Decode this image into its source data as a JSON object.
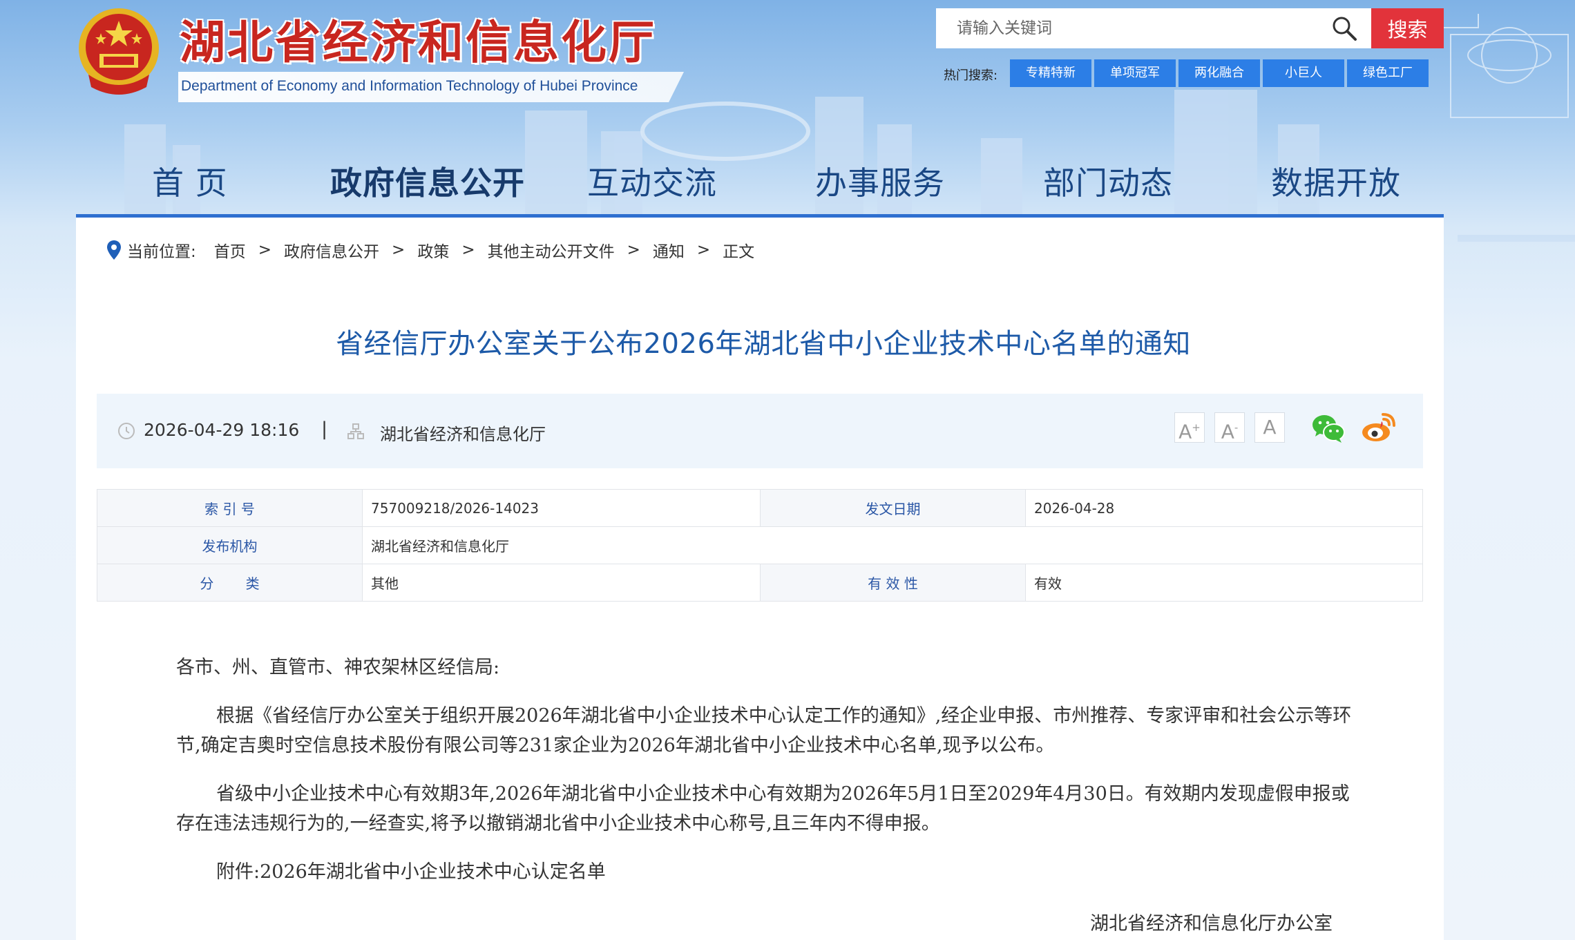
{
  "header": {
    "site_title": "湖北省经济和信息化厅",
    "site_subtitle": "Department of Economy and Information Technology of Hubei Province",
    "emblem_icon": "national-emblem"
  },
  "search": {
    "placeholder": "请输入关键词",
    "button_label": "搜索",
    "hot_label": "热门搜索:",
    "hot_tags": [
      "专精特新",
      "单项冠军",
      "两化融合",
      "小巨人",
      "绿色工厂"
    ]
  },
  "nav": {
    "items": [
      "首 页",
      "政府信息公开",
      "互动交流",
      "办事服务",
      "部门动态",
      "数据开放"
    ],
    "active": "政府信息公开"
  },
  "breadcrumb": {
    "label": "当前位置:",
    "items": [
      "首页",
      "政府信息公开",
      "政策",
      "其他主动公开文件",
      "通知",
      "正文"
    ],
    "separator": ">"
  },
  "article": {
    "title": "省经信厅办公室关于公布2026年湖北省中小企业技术中心名单的通知",
    "datetime": "2026-04-29 18:16",
    "divider": "|",
    "publisher": "湖北省经济和信息化厅",
    "font_buttons": [
      "A+",
      "A-",
      "A"
    ],
    "share_icons": [
      "wechat-icon",
      "weibo-icon"
    ]
  },
  "info_table": {
    "index_label": "索 引 号",
    "index_value": "757009218/2026-14023",
    "date_label": "发文日期",
    "date_value": "2026-04-28",
    "org_label": "发布机构",
    "org_value": "湖北省经济和信息化厅",
    "category_label": "分 类",
    "category_value": "其他",
    "validity_label": "有 效 性",
    "validity_value": "有效"
  },
  "body": {
    "salutation": "各市、州、直管市、神农架林区经信局:",
    "p1": "根据《省经信厅办公室关于组织开展2026年湖北省中小企业技术中心认定工作的通知》,经企业申报、市州推荐、专家评审和社会公示等环节,确定吉奥时空信息技术股份有限公司等231家企业为2026年湖北省中小企业技术中心名单,现予以公布。",
    "p2": "省级中小企业技术中心有效期3年,2026年湖北省中小企业技术中心有效期为2026年5月1日至2029年4月30日。有效期内发现虚假申报或存在违法违规行为的,一经查实,将予以撤销湖北省中小企业技术中心称号,且三年内不得申报。",
    "p3": "附件:2026年湖北省中小企业技术中心认定名单",
    "signature": "湖北省经济和信息化厅办公室"
  },
  "colors": {
    "title_red": "#c8261f",
    "nav_blue": "#1a4784",
    "search_red": "#e2333b",
    "tag_blue": "#2c7ee6",
    "article_title_blue": "#1d5aa8"
  }
}
